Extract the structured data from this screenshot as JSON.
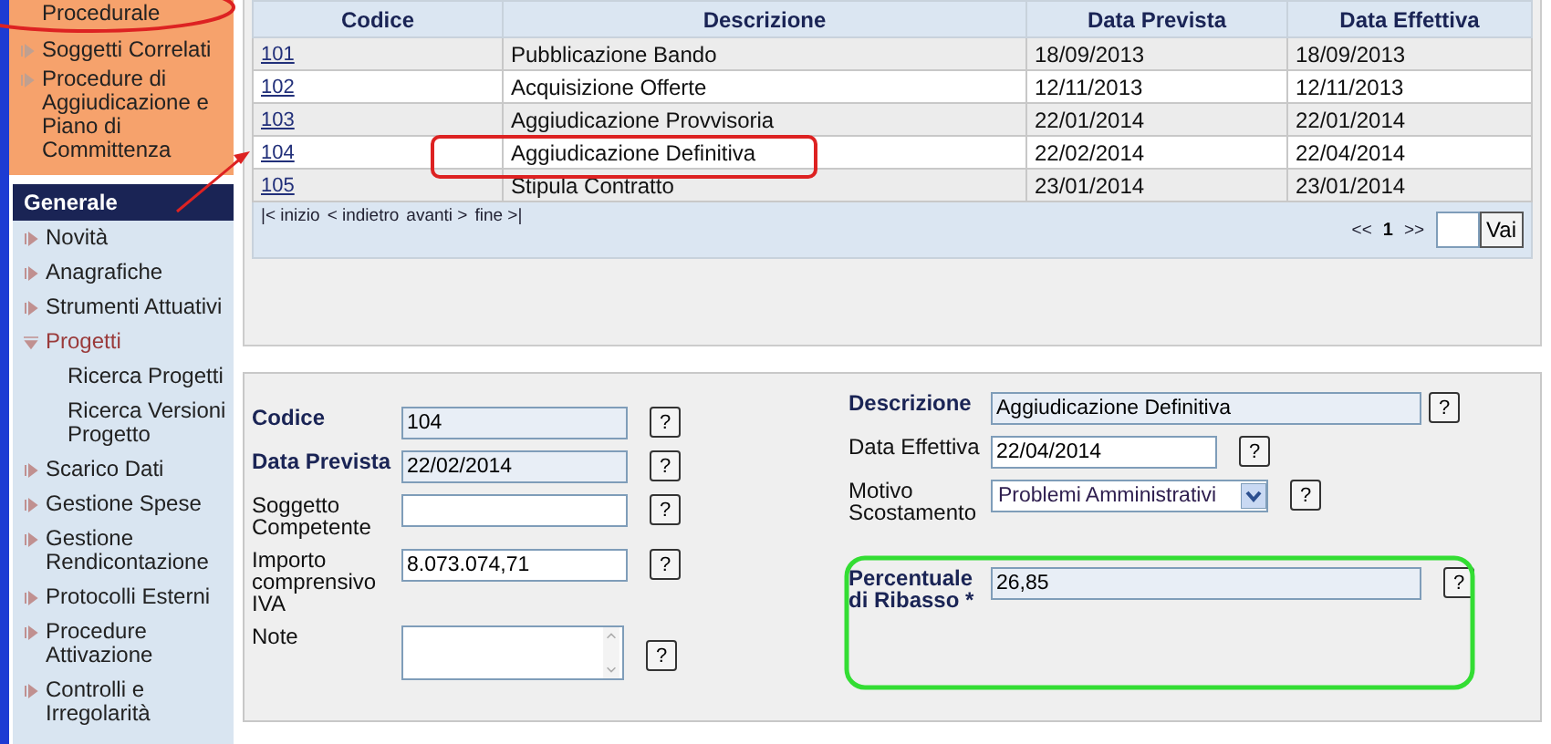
{
  "sidebar": {
    "top_items": [
      {
        "label": "Procedurale"
      },
      {
        "label": "Soggetti Correlati"
      },
      {
        "label": "Procedure di Aggiudicazione e Piano di Committenza"
      }
    ],
    "section_title": "Generale",
    "items": [
      {
        "label": "Novità",
        "expanded": false
      },
      {
        "label": "Anagrafiche",
        "expanded": false
      },
      {
        "label": "Strumenti Attuativi",
        "expanded": false
      },
      {
        "label": "Progetti",
        "expanded": true,
        "children": [
          {
            "label": "Ricerca Progetti"
          },
          {
            "label": "Ricerca Versioni Progetto"
          }
        ]
      },
      {
        "label": "Scarico Dati",
        "expanded": false
      },
      {
        "label": "Gestione Spese",
        "expanded": false
      },
      {
        "label": "Gestione Rendicontazione",
        "expanded": false
      },
      {
        "label": "Protocolli Esterni",
        "expanded": false
      },
      {
        "label": "Procedure Attivazione",
        "expanded": false
      },
      {
        "label": "Controlli e Irregolarità",
        "expanded": false
      }
    ]
  },
  "table": {
    "columns": [
      "Codice",
      "Descrizione",
      "Data Prevista",
      "Data Effettiva"
    ],
    "rows": [
      [
        "101",
        "Pubblicazione Bando",
        "18/09/2013",
        "18/09/2013"
      ],
      [
        "102",
        "Acquisizione Offerte",
        "12/11/2013",
        "12/11/2013"
      ],
      [
        "103",
        "Aggiudicazione Provvisoria",
        "22/01/2014",
        "22/01/2014"
      ],
      [
        "104",
        "Aggiudicazione Definitiva",
        "22/02/2014",
        "22/04/2014"
      ],
      [
        "105",
        "Stipula Contratto",
        "23/01/2014",
        "23/01/2014"
      ]
    ],
    "pager_links": [
      "|< inizio",
      "< indietro",
      "avanti >",
      "fine >|"
    ],
    "page_nav": {
      "prev": "<<",
      "current": "1",
      "next": ">>",
      "go_button": "Vai"
    }
  },
  "form": {
    "left": [
      {
        "label": "Codice",
        "required": true,
        "kind": "text",
        "value": "104",
        "readonly": true,
        "help": "?"
      },
      {
        "label": "Data Prevista",
        "required": true,
        "kind": "text",
        "value": "22/02/2014",
        "readonly": true,
        "help": "?"
      },
      {
        "label": "Soggetto Competente",
        "required": false,
        "kind": "text",
        "readonly": false,
        "help": "?"
      },
      {
        "label": "Importo comprensivo IVA",
        "required": false,
        "kind": "text",
        "value": "8.073.074,71",
        "readonly": false,
        "help": "?"
      },
      {
        "label": "Note",
        "required": false,
        "kind": "textarea",
        "readonly": false,
        "help": "?"
      }
    ],
    "right": [
      {
        "label": "Descrizione",
        "required": true,
        "kind": "wide",
        "value": "Aggiudicazione Definitiva",
        "readonly": true,
        "help": "?"
      },
      {
        "label": "Data Effettiva",
        "required": false,
        "kind": "text",
        "value": "22/04/2014",
        "readonly": false,
        "help": "?"
      },
      {
        "label": "Motivo Scostamento",
        "required": false,
        "kind": "select",
        "value": "Problemi Amministrativi",
        "readonly": false,
        "help": "?"
      },
      {
        "label": "Percentuale di Ribasso *",
        "required": true,
        "kind": "wide",
        "value": "26,85",
        "readonly": true,
        "help": "?"
      }
    ]
  }
}
